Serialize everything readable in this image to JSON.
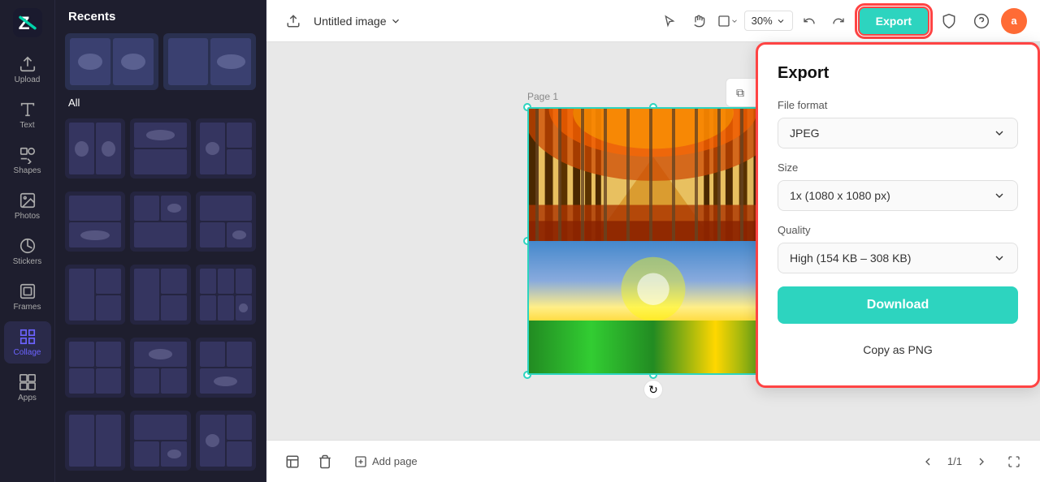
{
  "app": {
    "logo_text": "Z",
    "title": "Untitled image"
  },
  "sidebar": {
    "items": [
      {
        "id": "upload",
        "label": "Upload",
        "icon": "upload-icon"
      },
      {
        "id": "text",
        "label": "Text",
        "icon": "text-icon"
      },
      {
        "id": "shapes",
        "label": "Shapes",
        "icon": "shapes-icon"
      },
      {
        "id": "photos",
        "label": "Photos",
        "icon": "photos-icon"
      },
      {
        "id": "stickers",
        "label": "Stickers",
        "icon": "stickers-icon"
      },
      {
        "id": "frames",
        "label": "Frames",
        "icon": "frames-icon"
      },
      {
        "id": "collage",
        "label": "Collage",
        "icon": "collage-icon",
        "active": true
      },
      {
        "id": "apps",
        "label": "Apps",
        "icon": "apps-icon"
      }
    ]
  },
  "left_panel": {
    "header": "Recents",
    "section_all": "All"
  },
  "toolbar": {
    "zoom": "30%",
    "export_label": "Export"
  },
  "canvas": {
    "page_label": "Page 1"
  },
  "export_panel": {
    "title": "Export",
    "file_format_label": "File format",
    "file_format_value": "JPEG",
    "size_label": "Size",
    "size_value": "1x (1080 x 1080 px)",
    "quality_label": "Quality",
    "quality_value": "High (154 KB – 308 KB)",
    "download_label": "Download",
    "copy_png_label": "Copy as PNG"
  },
  "bottom_bar": {
    "add_page_label": "Add page",
    "page_indicator": "1/1"
  }
}
